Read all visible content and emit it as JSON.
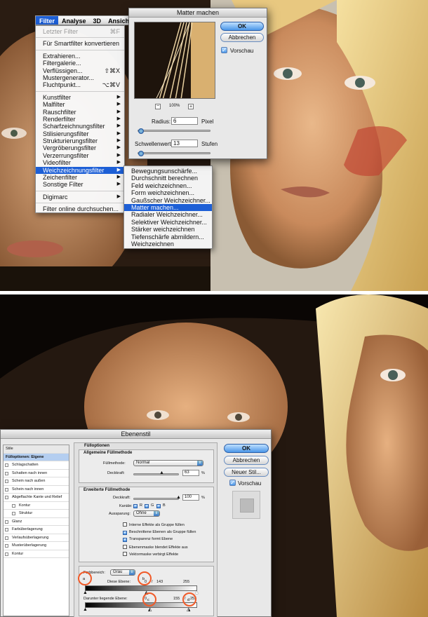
{
  "menubar": {
    "items": [
      "Filter",
      "Analyse",
      "3D",
      "Ansicht"
    ]
  },
  "filter_menu": {
    "items": [
      {
        "label": "Letzter Filter",
        "shortcut": "⌘F",
        "disabled": true
      },
      {
        "sep": true
      },
      {
        "label": "Für Smartfilter konvertieren"
      },
      {
        "sep": true
      },
      {
        "label": "Extrahieren..."
      },
      {
        "label": "Filtergalerie..."
      },
      {
        "label": "Verflüssigen...",
        "shortcut": "⇧⌘X"
      },
      {
        "label": "Mustergenerator..."
      },
      {
        "label": "Fluchtpunkt...",
        "shortcut": "⌥⌘V"
      },
      {
        "sep": true
      },
      {
        "label": "Kunstfilter",
        "sub": true
      },
      {
        "label": "Malfilter",
        "sub": true
      },
      {
        "label": "Rauschfilter",
        "sub": true
      },
      {
        "label": "Renderfilter",
        "sub": true
      },
      {
        "label": "Scharfzeichnungsfilter",
        "sub": true
      },
      {
        "label": "Stilisierungsfilter",
        "sub": true
      },
      {
        "label": "Strukturierungsfilter",
        "sub": true
      },
      {
        "label": "Vergröberungsfilter",
        "sub": true
      },
      {
        "label": "Verzerrungsfilter",
        "sub": true
      },
      {
        "label": "Videofilter",
        "sub": true
      },
      {
        "label": "Weichzeichnungsfilter",
        "sub": true,
        "selected": true
      },
      {
        "label": "Zeichenfilter",
        "sub": true
      },
      {
        "label": "Sonstige Filter",
        "sub": true
      },
      {
        "sep": true
      },
      {
        "label": "Digimarc",
        "sub": true
      },
      {
        "sep": true
      },
      {
        "label": "Filter online durchsuchen..."
      }
    ]
  },
  "blur_submenu": {
    "items": [
      {
        "label": "Bewegungsunschärfe..."
      },
      {
        "label": "Durchschnitt berechnen"
      },
      {
        "label": "Feld weichzeichnen..."
      },
      {
        "label": "Form weichzeichnen..."
      },
      {
        "label": "Gaußscher Weichzeichner..."
      },
      {
        "label": "Matter machen...",
        "selected": true
      },
      {
        "label": "Radialer Weichzeichner..."
      },
      {
        "label": "Selektiver Weichzeichner..."
      },
      {
        "label": "Stärker weichzeichnen"
      },
      {
        "label": "Tiefenschärfe abmildern..."
      },
      {
        "label": "Weichzeichnen"
      }
    ]
  },
  "matter_dialog": {
    "title": "Matter machen",
    "ok": "OK",
    "cancel": "Abbrechen",
    "preview_label": "Vorschau",
    "preview_checked": true,
    "zoom_minus": "−",
    "zoom": "100%",
    "zoom_plus": "+",
    "radius_label": "Radius:",
    "radius_value": "6",
    "radius_unit": "Pixel",
    "radius_level": 0.05,
    "threshold_label": "Schwellenwert:",
    "threshold_value": "13",
    "threshold_unit": "Stufen",
    "threshold_level": 0.05
  },
  "ebenenstil": {
    "title": "Ebenenstil",
    "ok": "OK",
    "cancel": "Abbrechen",
    "new_style": "Neuer Stil...",
    "preview_label": "Vorschau",
    "preview_checked": true,
    "styles": [
      {
        "label": "Stile",
        "type": "head"
      },
      {
        "label": "Fülloptionen: Eigene",
        "type": "sel"
      },
      {
        "label": "Schlagschatten",
        "type": "chk"
      },
      {
        "label": "Schatten nach innen",
        "type": "chk"
      },
      {
        "label": "Schein nach außen",
        "type": "chk"
      },
      {
        "label": "Schein nach innen",
        "type": "chk"
      },
      {
        "label": "Abgeflachte Kante und Relief",
        "type": "chk"
      },
      {
        "label": "Kontur",
        "type": "sub"
      },
      {
        "label": "Struktur",
        "type": "sub"
      },
      {
        "label": "Glanz",
        "type": "chk"
      },
      {
        "label": "Farbüberlagerung",
        "type": "chk"
      },
      {
        "label": "Verlaufsüberlagerung",
        "type": "chk"
      },
      {
        "label": "Musterüberlagerung",
        "type": "chk"
      },
      {
        "label": "Kontur",
        "type": "chk"
      }
    ],
    "blend_options_title": "Fülloptionen",
    "general_title": "Allgemeine Füllmethode",
    "blend_mode_label": "Füllmethode:",
    "blend_mode_value": "Normal",
    "opacity_label": "Deckkraft:",
    "opacity_value": "63",
    "opacity_unit": "%",
    "opacity_level": 0.63,
    "advanced_title": "Erweiterte Füllmethode",
    "fill_opacity_label": "Deckkraft:",
    "fill_opacity_value": "100",
    "fill_opacity_unit": "%",
    "fill_opacity_level": 1.0,
    "channels_label": "Kanäle:",
    "channels": [
      "R",
      "G",
      "B"
    ],
    "knockout_label": "Aussparung:",
    "knockout_value": "Ohne",
    "options": [
      {
        "label": "Interne Effekte als Gruppe füllen",
        "checked": false
      },
      {
        "label": "Beschnittene Ebenen als Gruppe füllen",
        "checked": true
      },
      {
        "label": "Transparenz formt Ebene",
        "checked": true
      },
      {
        "label": "Ebenenmaske blendet Effekte aus",
        "checked": false
      },
      {
        "label": "Vektormaske verbirgt Effekte",
        "checked": false
      }
    ],
    "blend_if_label": "Farbbereich:",
    "blend_if_value": "Grau",
    "this_layer_label": "Diese Ebene:",
    "this_layer_values": "0 / 143       255",
    "this_layer_v0": "0",
    "this_layer_v1": "/",
    "this_layer_v2": "143",
    "this_layer_v3": "255",
    "underlying_label": "Darunter liegende Ebene:",
    "underlying_v0": "0",
    "underlying_v1": "155",
    "underlying_v2": "/",
    "underlying_v3": "255",
    "annotations": [
      "a",
      "b",
      "c",
      "d"
    ]
  },
  "colors": {
    "accent": "#1d5fd6",
    "highlight_circle": "#f05a28"
  }
}
